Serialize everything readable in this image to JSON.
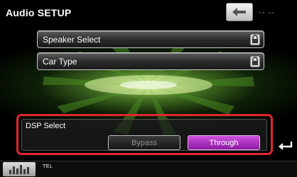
{
  "header": {
    "title": "Audio SETUP",
    "placeholder_dashes": "-- --"
  },
  "menu": {
    "speaker_select": "Speaker Select",
    "car_type": "Car Type"
  },
  "dsp": {
    "label": "DSP Select",
    "options": [
      "Bypass",
      "Through"
    ],
    "selected": "Through"
  },
  "bottombar": {
    "tel_label": "TEL"
  },
  "colors": {
    "highlight": "#e0262e",
    "selected_option": "#c040d8",
    "accent_green": "#9be05a"
  },
  "icons": [
    "back-arrow-icon",
    "lock-icon",
    "return-icon",
    "equalizer-icon"
  ]
}
